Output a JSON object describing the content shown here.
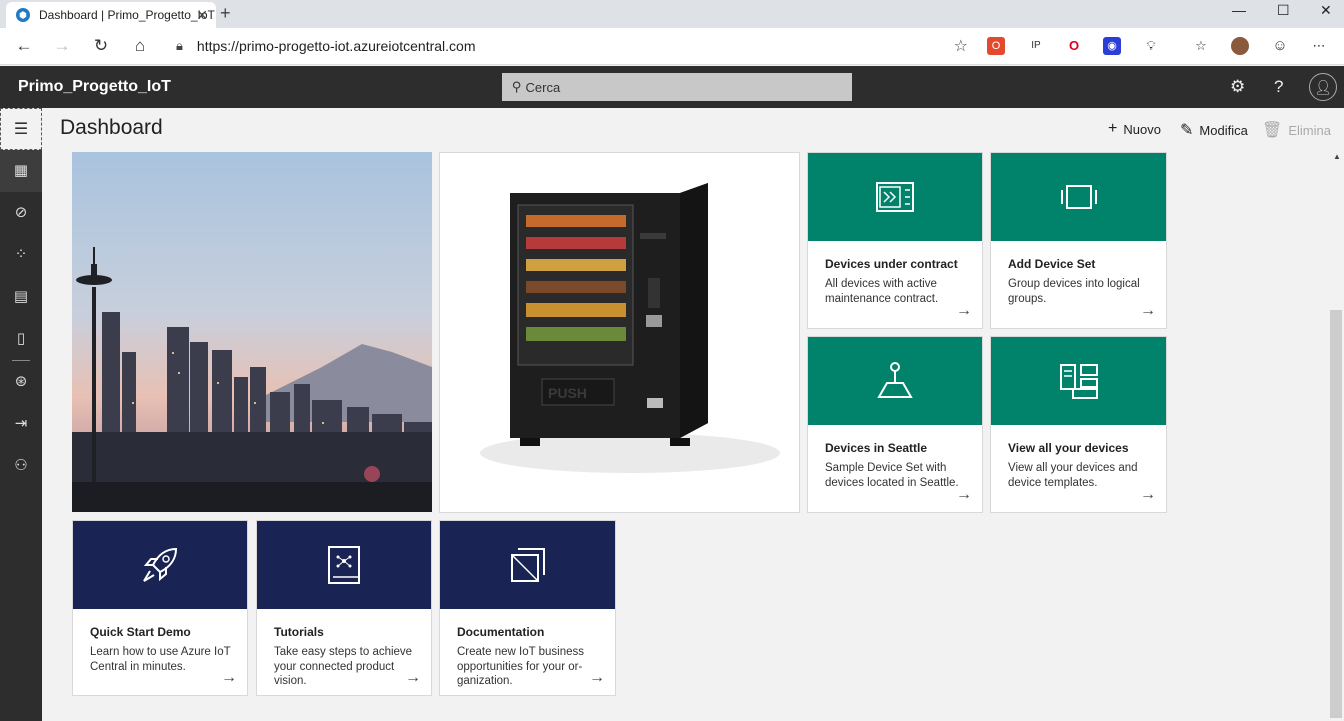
{
  "browser": {
    "tab_title": "Dashboard | Primo_Progetto_IoT",
    "tab_close": "✕",
    "new_tab": "+",
    "url": "https://primo-progetto-iot.azureiotcentral.com",
    "window_controls": [
      "—",
      "☐",
      "✕"
    ],
    "extension_icons": [
      "office-icon",
      "ip-icon",
      "opera-icon",
      "screen-icon",
      "lightbulb-icon",
      "favorites-icon",
      "profile-icon",
      "emoji-icon",
      "more-icon"
    ]
  },
  "app": {
    "title": "Primo_Progetto_IoT",
    "search_placeholder": "Cerca"
  },
  "page": {
    "title": "Dashboard",
    "actions": {
      "new": "Nuovo",
      "edit": "Modifica",
      "delete": "Elimina"
    }
  },
  "rail": {
    "items": [
      "menu-icon",
      "dashboard-icon",
      "analytics-icon",
      "devices-icon",
      "chart-icon",
      "device-templates-icon",
      "rules-icon",
      "jobs-icon",
      "users-icon"
    ]
  },
  "tiles": [
    {
      "title": "Devices under contract",
      "description": "All devices with active maintenance contract.",
      "color": "#00826b"
    },
    {
      "title": "Add Device Set",
      "description": "Group devices into logical groups.",
      "color": "#00826b"
    },
    {
      "title": "Devices in Seattle",
      "description": "Sample Device Set with devices located in Seattle.",
      "color": "#00826b"
    },
    {
      "title": "View all your devices",
      "description": "View all your devices and device templates.",
      "color": "#00826b"
    },
    {
      "title": "Quick Start Demo",
      "description": "Learn how to use Azure IoT Central in minutes.",
      "color": "#1a2454"
    },
    {
      "title": "Tutorials",
      "description": "Take easy steps to achieve your connected product vision.",
      "color": "#1a2454"
    },
    {
      "title": "Documentation",
      "description": "Create new IoT business opportunities for your or-ganization.",
      "color": "#1a2454"
    }
  ],
  "vending_machine": {
    "push_label": "PUSH"
  }
}
